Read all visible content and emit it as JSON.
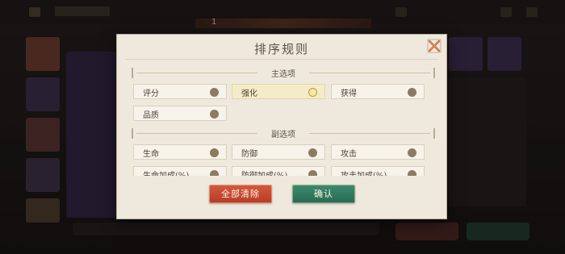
{
  "background": {
    "progress_text": "1"
  },
  "dialog": {
    "title": "排序规则",
    "primary_section": {
      "heading": "主选项",
      "options": [
        {
          "label": "评分",
          "selected": false
        },
        {
          "label": "强化",
          "selected": true
        },
        {
          "label": "获得",
          "selected": false
        },
        {
          "label": "品质",
          "selected": false
        }
      ]
    },
    "secondary_section": {
      "heading": "副选项",
      "options": [
        {
          "label": "生命",
          "selected": false
        },
        {
          "label": "防御",
          "selected": false
        },
        {
          "label": "攻击",
          "selected": false
        },
        {
          "label": "生命加成(%)",
          "selected": false
        },
        {
          "label": "防御加成(%)",
          "selected": false
        },
        {
          "label": "攻击加成(%)",
          "selected": false
        }
      ]
    },
    "buttons": {
      "clear_all": "全部清除",
      "confirm": "确认"
    }
  },
  "colors": {
    "clear_button": "#c44a33",
    "confirm_button": "#2f7a5f",
    "radio_unselected": "#8a7c63",
    "radio_selected": "#f6e9a0"
  }
}
